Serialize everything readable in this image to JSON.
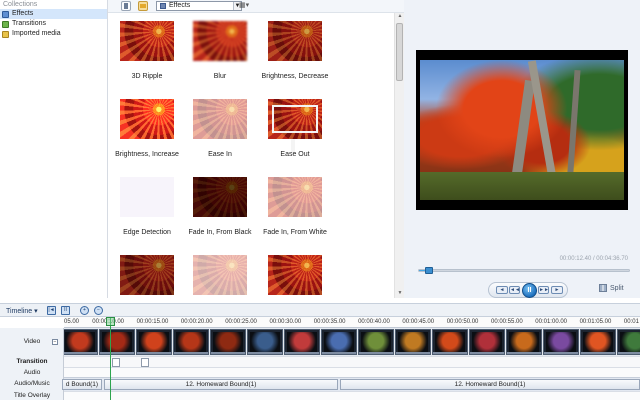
{
  "collections": {
    "header": "Collections",
    "items": [
      {
        "label": "Effects",
        "icon": "effects-icon",
        "selected": true
      },
      {
        "label": "Transitions",
        "icon": "transitions-icon",
        "selected": false
      },
      {
        "label": "Imported media",
        "icon": "imported-media-icon",
        "selected": false
      }
    ]
  },
  "toolbar": {
    "combo_value": "Effects",
    "view_icon": "view-options-icon"
  },
  "effects": [
    {
      "label": "3D Ripple"
    },
    {
      "label": "Blur"
    },
    {
      "label": "Brightness, Decrease"
    },
    {
      "label": "Brightness, Increase"
    },
    {
      "label": "Ease In"
    },
    {
      "label": "Ease Out"
    },
    {
      "label": "Edge Detection"
    },
    {
      "label": "Fade In, From Black"
    },
    {
      "label": "Fade In, From White"
    },
    {
      "label": ""
    },
    {
      "label": ""
    },
    {
      "label": ""
    }
  ],
  "preview": {
    "timecode": "00:00:12.40 / 00:04:36.70",
    "progress_fraction": 0.045,
    "split_label": "Split",
    "transport": {
      "prev": "◄◄",
      "play": "II",
      "next": "►►",
      "frame_back": "◄",
      "frame_fwd": "►"
    }
  },
  "timeline": {
    "label": "Timeline",
    "ruler": [
      "05.00",
      "00:00:10.00",
      "00:00:15.00",
      "00:00:20.00",
      "00:00:25.00",
      "00:00:30.00",
      "00:00:35.00",
      "00:00:40.00",
      "00:00:45.00",
      "00:00:50.00",
      "00:00:55.00",
      "00:01:00.00",
      "00:01:05.00",
      "00:01"
    ],
    "tracks": {
      "video": "Video",
      "transition": "Transition",
      "audio": "Audio",
      "audio_music": "Audio/Music",
      "title_overlay": "Title Overlay"
    },
    "music_clips": [
      "d Bound(1)",
      "12. Homeward Bound(1)",
      "12. Homeward Bound(1)"
    ],
    "clip_colors": [
      "#c23a1e",
      "#a52a16",
      "#d0421c",
      "#b53618",
      "#8e2a12",
      "#3a5d8c",
      "#c13b3b",
      "#4a6db0",
      "#6f8f3a",
      "#c07a22",
      "#d34a1a",
      "#b0303a",
      "#c86a1c",
      "#7a4aa0",
      "#e05522",
      "#3f7a3c",
      "#a53a6a",
      "#d2982a"
    ]
  }
}
